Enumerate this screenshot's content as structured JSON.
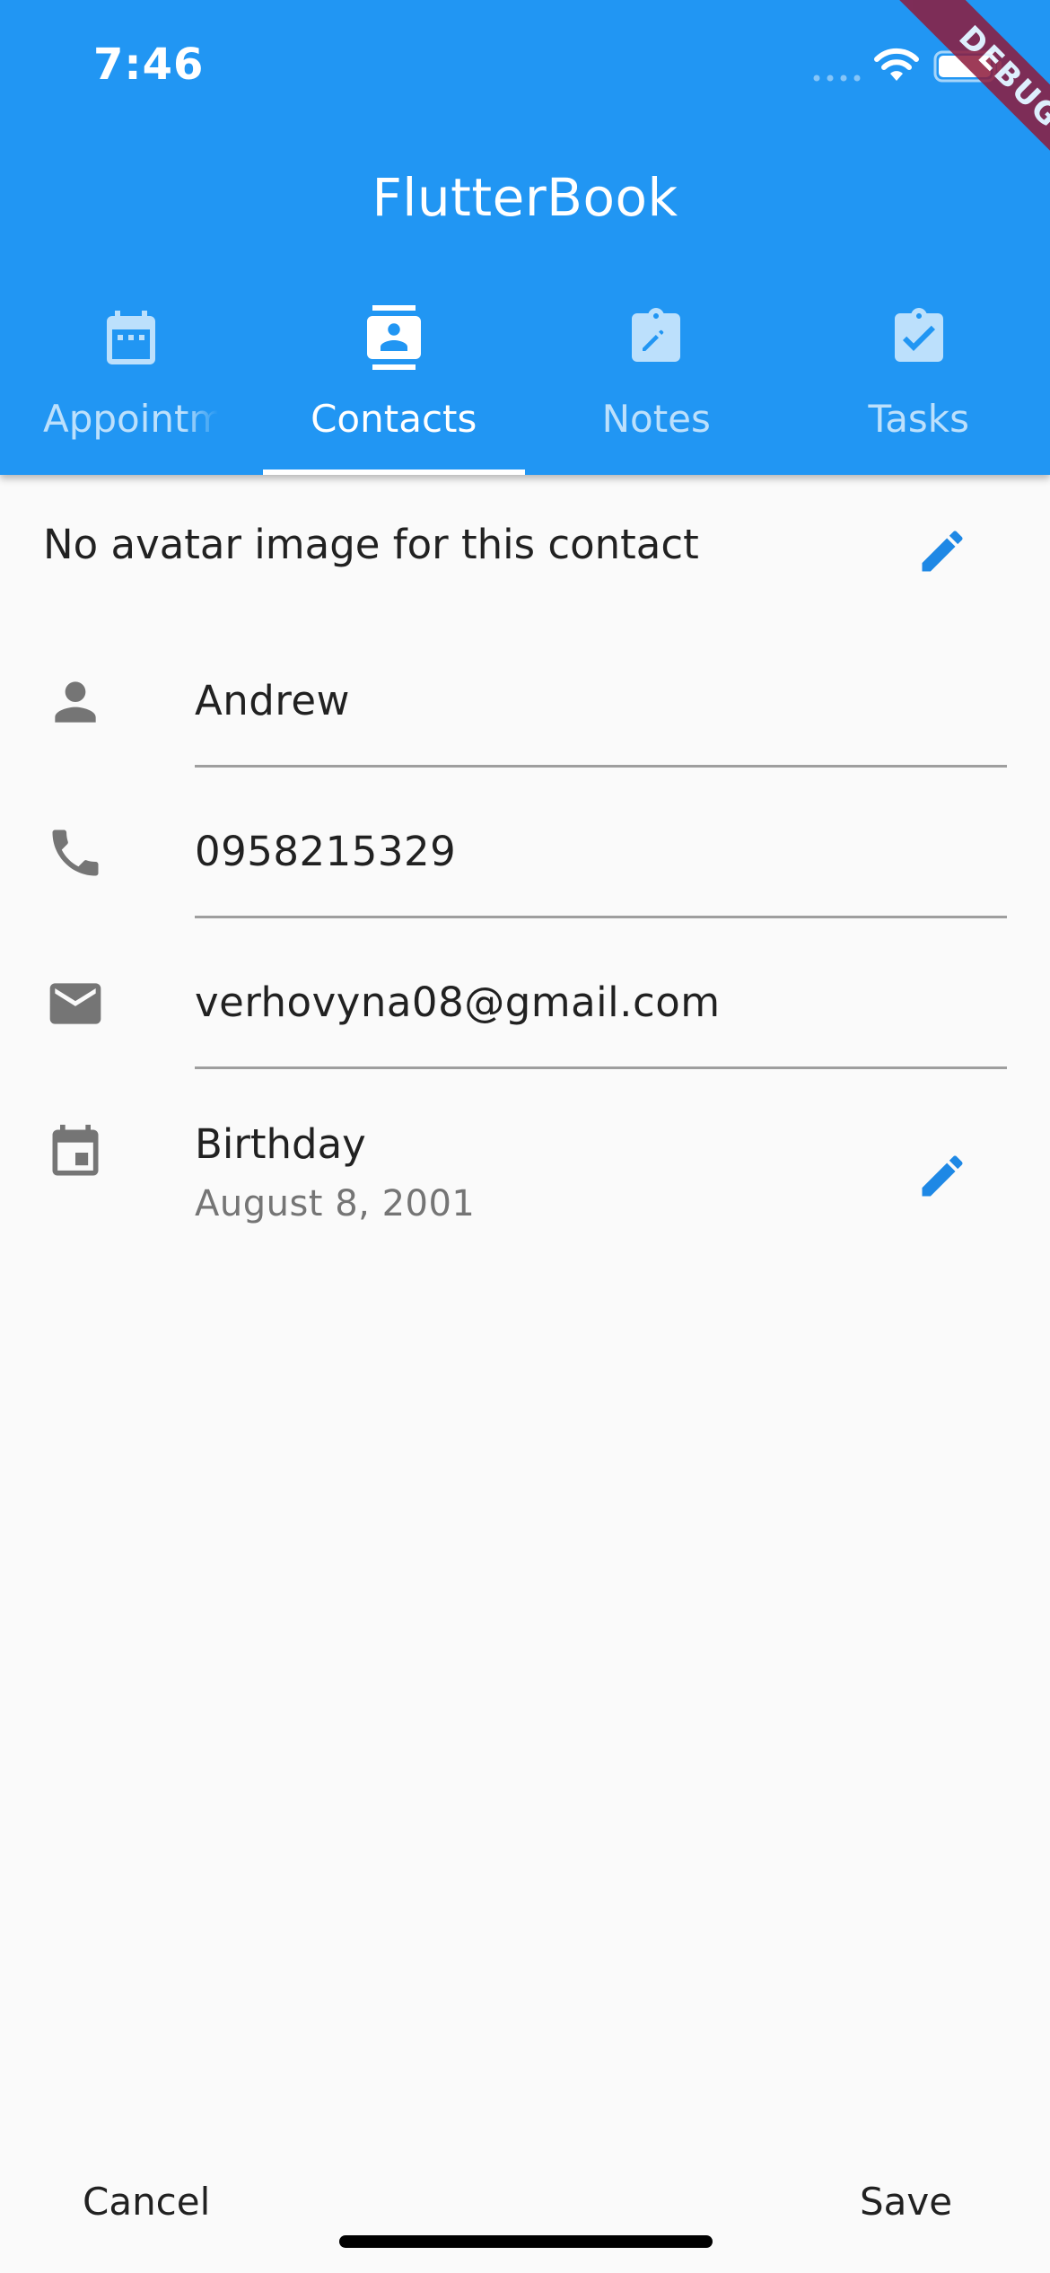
{
  "status_bar": {
    "time": "7:46"
  },
  "app": {
    "title": "FlutterBook",
    "debug_banner": "DEBUG",
    "accent_color": "#2196f3",
    "icon_color": "#1e88e5"
  },
  "tabs": [
    {
      "label": "Appointments",
      "icon": "calendar-icon",
      "active": false
    },
    {
      "label": "Contacts",
      "icon": "contacts-icon",
      "active": true
    },
    {
      "label": "Notes",
      "icon": "note-edit-icon",
      "active": false
    },
    {
      "label": "Tasks",
      "icon": "task-check-icon",
      "active": false
    }
  ],
  "contact": {
    "avatar_text": "No avatar image for this contact",
    "name": "Andrew",
    "phone": "0958215329",
    "email": "verhovyna08@gmail.com",
    "birthday_label": "Birthday",
    "birthday_value": "August 8, 2001"
  },
  "actions": {
    "cancel_label": "Cancel",
    "save_label": "Save"
  }
}
